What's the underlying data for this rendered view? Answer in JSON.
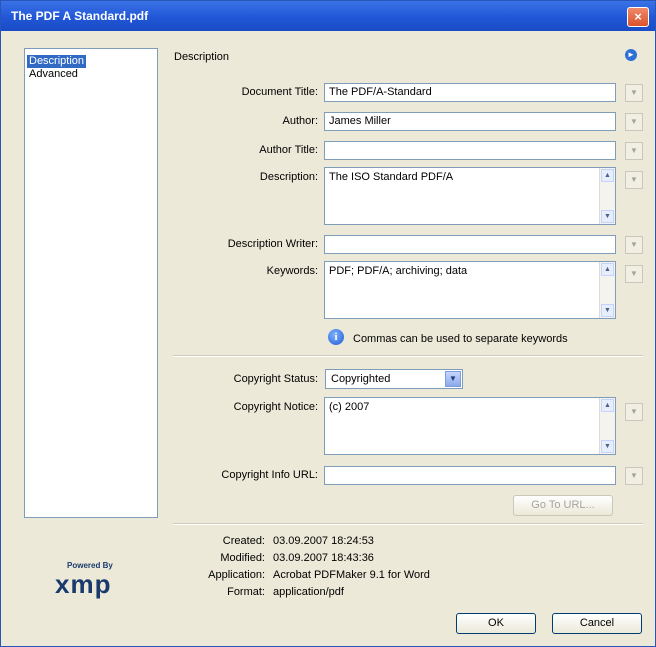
{
  "window": {
    "title": "The PDF A Standard.pdf",
    "close_glyph": "×"
  },
  "sidebar": {
    "items": [
      {
        "label": "Description"
      },
      {
        "label": "Advanced"
      }
    ]
  },
  "section": {
    "title": "Description",
    "info_icon": "info-circle-icon"
  },
  "fields": {
    "document_title": {
      "label": "Document Title:",
      "value": "The PDF/A-Standard"
    },
    "author": {
      "label": "Author:",
      "value": "James Miller"
    },
    "author_title": {
      "label": "Author Title:",
      "value": ""
    },
    "description": {
      "label": "Description:",
      "value": "The ISO Standard PDF/A"
    },
    "description_writer": {
      "label": "Description Writer:",
      "value": ""
    },
    "keywords": {
      "label": "Keywords:",
      "value": "PDF; PDF/A; archiving; data"
    },
    "keywords_note": "Commas can be used to separate keywords",
    "copyright_status": {
      "label": "Copyright Status:",
      "value": "Copyrighted"
    },
    "copyright_notice": {
      "label": "Copyright Notice:",
      "value": "(c) 2007"
    },
    "copyright_url": {
      "label": "Copyright Info URL:",
      "value": ""
    }
  },
  "buttons": {
    "go_to_url": "Go To URL...",
    "ok": "OK",
    "cancel": "Cancel"
  },
  "metadata": {
    "created": {
      "label": "Created:",
      "value": "03.09.2007 18:24:53"
    },
    "modified": {
      "label": "Modified:",
      "value": "03.09.2007 18:43:36"
    },
    "application": {
      "label": "Application:",
      "value": "Acrobat PDFMaker 9.1 for Word"
    },
    "format": {
      "label": "Format:",
      "value": "application/pdf"
    }
  },
  "logo": {
    "powered_by": "Powered By",
    "name": "xmp"
  },
  "colors": {
    "title_bar": "#1f55d6",
    "selection": "#316ac5",
    "dialog_bg": "#ece9d8"
  }
}
